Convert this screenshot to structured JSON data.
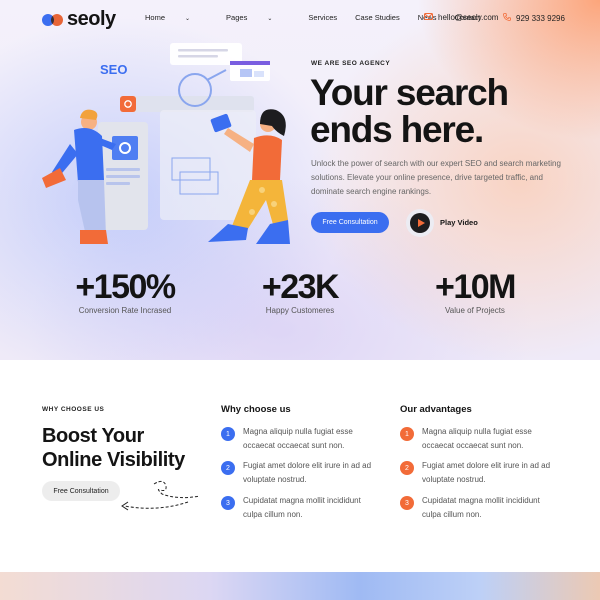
{
  "brand": {
    "name": "seoly"
  },
  "nav": {
    "items": [
      {
        "label": "Home",
        "dropdown": true
      },
      {
        "label": "Pages",
        "dropdown": true
      },
      {
        "label": "Services",
        "dropdown": false
      },
      {
        "label": "Case Studies",
        "dropdown": false
      },
      {
        "label": "News",
        "dropdown": false
      },
      {
        "label": "Contact",
        "dropdown": false
      }
    ]
  },
  "contact": {
    "email": "hello@seoly.com",
    "phone": "929 333 9296"
  },
  "hero": {
    "eyebrow": "WE ARE SEO AGENCY",
    "headline_line1": "Your search",
    "headline_line2": "ends here.",
    "description": "Unlock the power of search with our expert SEO and search marketing solutions. Elevate your online presence, drive targeted traffic, and dominate search engine rankings.",
    "cta_label": "Free Consultation",
    "video_label": "Play Video",
    "illustration_badge": "SEO"
  },
  "stats": [
    {
      "value": "+150%",
      "label": "Conversion Rate Incrased"
    },
    {
      "value": "+23K",
      "label": "Happy Customeres"
    },
    {
      "value": "+10M",
      "label": "Value of Projects"
    }
  ],
  "why": {
    "eyebrow": "WHY CHOOSE US",
    "title_line1": "Boost Your",
    "title_line2": "Online Visibility",
    "cta_label": "Free Consultation"
  },
  "columns": [
    {
      "title": "Why choose us",
      "items": [
        {
          "n": "1",
          "text": "Magna aliquip nulla fugiat esse occaecat occaecat sunt non."
        },
        {
          "n": "2",
          "text": "Fugiat amet dolore elit irure in ad ad voluptate nostrud."
        },
        {
          "n": "3",
          "text": "Cupidatat magna mollit incididunt culpa cillum non."
        }
      ]
    },
    {
      "title": "Our advantages",
      "items": [
        {
          "n": "1",
          "text": "Magna aliquip nulla fugiat esse occaecat occaecat sunt non."
        },
        {
          "n": "2",
          "text": "Fugiat amet dolore elit irure in ad ad voluptate nostrud."
        },
        {
          "n": "3",
          "text": "Cupidatat magna mollit incididunt culpa cillum non."
        }
      ]
    }
  ],
  "colors": {
    "accent_blue": "#3b6ef0",
    "accent_orange": "#f26b38",
    "text_dark": "#141414"
  },
  "icons": [
    "logo-circles-icon",
    "chevron-down-icon",
    "mail-icon",
    "phone-icon",
    "play-icon",
    "dashed-arrow-icon"
  ]
}
